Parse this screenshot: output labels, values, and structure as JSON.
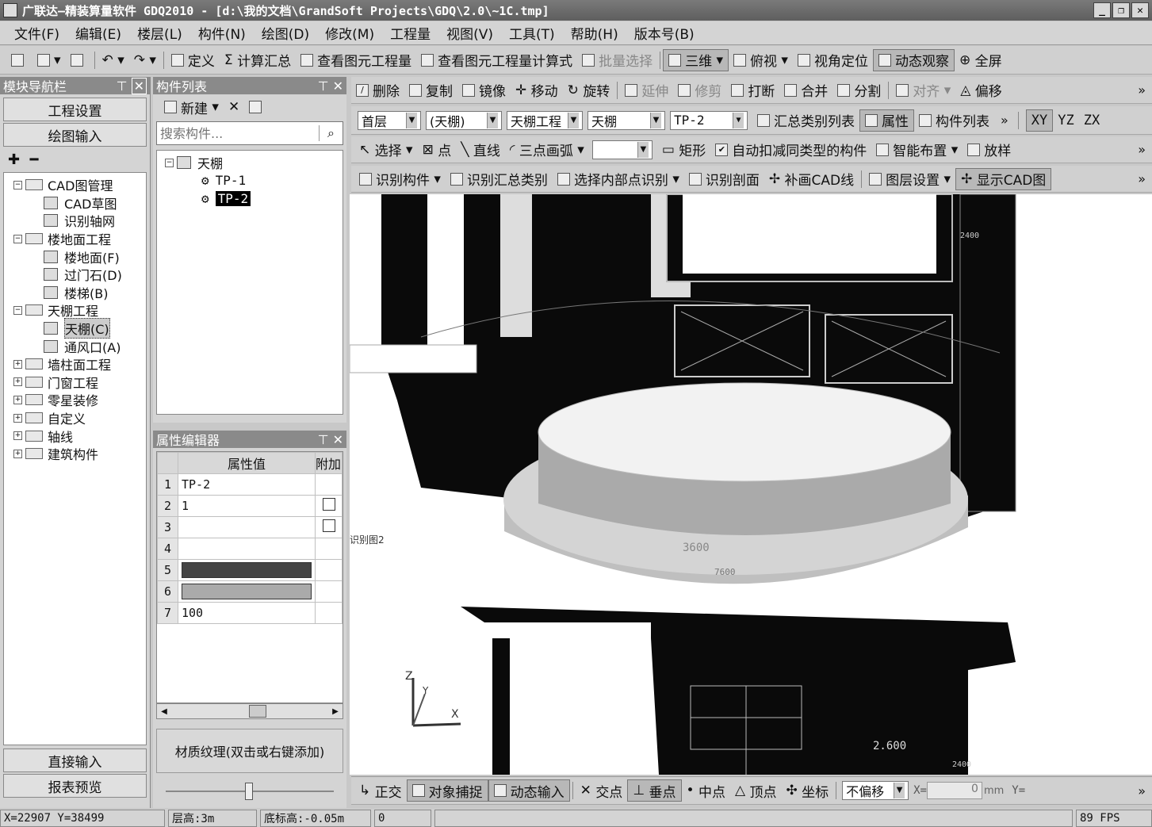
{
  "window": {
    "title": "广联达—精装算量软件 GDQ2010 - [d:\\我的文档\\GrandSoft Projects\\GDQ\\2.0\\~1C.tmp]"
  },
  "menu": [
    "文件(F)",
    "编辑(E)",
    "楼层(L)",
    "构件(N)",
    "绘图(D)",
    "修改(M)",
    "工程量",
    "视图(V)",
    "工具(T)",
    "帮助(H)",
    "版本号(B)"
  ],
  "toolbar1": {
    "define": "定义",
    "calc_summary": "计算汇总",
    "view_qty": "查看图元工程量",
    "view_formula": "查看图元工程量计算式",
    "batch_select": "批量选择",
    "view3d": "三维",
    "top_view": "俯视",
    "view_locate": "视角定位",
    "dynamic_observe": "动态观察",
    "fullscreen": "全屏"
  },
  "toolbar_edit": {
    "delete": "删除",
    "copy": "复制",
    "mirror": "镜像",
    "move": "移动",
    "rotate": "旋转",
    "extend": "延伸",
    "trim": "修剪",
    "break": "打断",
    "merge": "合并",
    "split": "分割",
    "align": "对齐",
    "offset": "偏移"
  },
  "toolbar_select": {
    "floor": "首层",
    "type_group": "(天棚)",
    "project": "天棚工程",
    "component": "天棚",
    "instance": "TP-2",
    "summary_list": "汇总类别列表",
    "properties": "属性",
    "component_list": "构件列表"
  },
  "axes_buttons": [
    "XY",
    "YZ",
    "ZX"
  ],
  "toolbar_draw": {
    "select": "选择",
    "point": "点",
    "line": "直线",
    "arc3": "三点画弧",
    "rect": "矩形",
    "auto_deduct": "自动扣减同类型的构件",
    "smart_layout": "智能布置",
    "offset_draw": "放样"
  },
  "toolbar_cad": {
    "identify": "识别构件",
    "identify_summary": "识别汇总类别",
    "select_inner": "选择内部点识别",
    "identify_section": "识别剖面",
    "add_cad_line": "补画CAD线",
    "layer_settings": "图层设置",
    "show_cad": "显示CAD图"
  },
  "nav": {
    "title": "模块导航栏",
    "project_settings": "工程设置",
    "drawing_input": "绘图输入",
    "direct_input": "直接输入",
    "report_preview": "报表预览"
  },
  "nav_tree": [
    {
      "lv": 0,
      "pm": "−",
      "label": "CAD图管理"
    },
    {
      "lv": 1,
      "label": "CAD草图"
    },
    {
      "lv": 1,
      "label": "识别轴网"
    },
    {
      "lv": 0,
      "pm": "−",
      "label": "楼地面工程"
    },
    {
      "lv": 1,
      "label": "楼地面(F)"
    },
    {
      "lv": 1,
      "label": "过门石(D)"
    },
    {
      "lv": 1,
      "label": "楼梯(B)"
    },
    {
      "lv": 0,
      "pm": "−",
      "label": "天棚工程"
    },
    {
      "lv": 1,
      "label": "天棚(C)",
      "sel": true
    },
    {
      "lv": 1,
      "label": "通风口(A)"
    },
    {
      "lv": 0,
      "pm": "+",
      "label": "墙柱面工程"
    },
    {
      "lv": 0,
      "pm": "+",
      "label": "门窗工程"
    },
    {
      "lv": 0,
      "pm": "+",
      "label": "零星装修"
    },
    {
      "lv": 0,
      "pm": "+",
      "label": "自定义"
    },
    {
      "lv": 0,
      "pm": "+",
      "label": "轴线"
    },
    {
      "lv": 0,
      "pm": "+",
      "label": "建筑构件"
    }
  ],
  "component_panel": {
    "title": "构件列表",
    "new": "新建",
    "search_placeholder": "搜索构件...",
    "root": "天棚",
    "items": [
      "TP-1",
      "TP-2"
    ],
    "selected": "TP-2"
  },
  "prop_editor": {
    "title": "属性编辑器",
    "col_value": "属性值",
    "col_extra": "附加",
    "rows": [
      {
        "n": "1",
        "v": "TP-2",
        "chk": false,
        "swatch": ""
      },
      {
        "n": "2",
        "v": "1",
        "chk": true,
        "swatch": ""
      },
      {
        "n": "3",
        "v": "",
        "chk": true,
        "swatch": ""
      },
      {
        "n": "4",
        "v": "",
        "chk": false,
        "swatch": ""
      },
      {
        "n": "5",
        "v": "",
        "chk": false,
        "swatch": "#444444"
      },
      {
        "n": "6",
        "v": "",
        "chk": false,
        "swatch": "#aaaaaa"
      },
      {
        "n": "7",
        "v": "100",
        "chk": false,
        "swatch": ""
      }
    ],
    "texture": "材质纹理(双击或右键添加)"
  },
  "viewport": {
    "dim1": "3600",
    "dim2": "7600",
    "dim3": "2.600",
    "label_left": "识别图2",
    "small_dims": [
      "2400",
      "2400"
    ]
  },
  "snapbar": {
    "ortho": "正交",
    "obj_snap": "对象捕捉",
    "dyn_input": "动态输入",
    "intersect": "交点",
    "perp": "垂点",
    "mid": "中点",
    "vertex": "顶点",
    "coord": "坐标",
    "offset_mode": "不偏移",
    "x_label": "X=",
    "x_val": "0",
    "unit": "mm",
    "y_label": "Y="
  },
  "status": {
    "coords": "X=22907 Y=38499",
    "floor_h": "层高:3m",
    "base_h": "底标高:-0.05m",
    "val": "0",
    "fps": "89 FPS"
  }
}
